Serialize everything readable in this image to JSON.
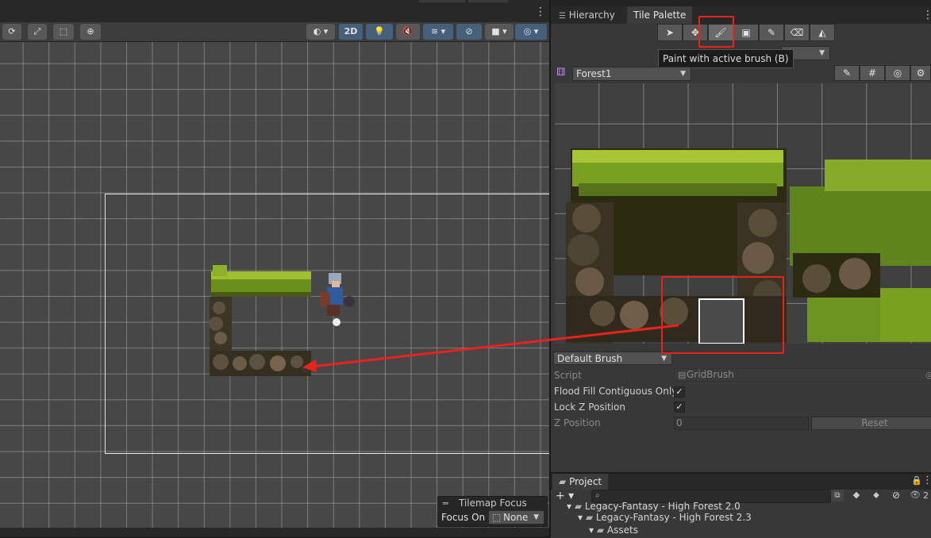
{
  "scene_toolbar": {
    "mode_2d_label": "2D"
  },
  "tabs": {
    "hierarchy_label": "Hierarchy",
    "tile_palette_label": "Tile Palette"
  },
  "tile_palette": {
    "tooltip": "Paint with active brush (B)",
    "palette_name": "Forest1",
    "brush_name": "Default Brush",
    "script_label": "Script",
    "script_value": "GridBrush",
    "flood_fill_label": "Flood Fill Contiguous Only",
    "flood_fill_checked": true,
    "lock_z_label": "Lock Z Position",
    "lock_z_checked": true,
    "z_position_label": "Z Position",
    "z_position_value": "0",
    "reset_label": "Reset"
  },
  "tilemap_focus": {
    "title": "Tilemap Focus",
    "focus_on_label": "Focus On",
    "focus_value": "None"
  },
  "project": {
    "tab_label": "Project",
    "visible_count": "2",
    "tree": [
      "Legacy-Fantasy - High Forest 2.0",
      "Legacy-Fantasy - High Forest 2.3",
      "Assets"
    ]
  },
  "colors": {
    "highlight_red": "#e8231b",
    "accent_blue": "#46607c"
  }
}
